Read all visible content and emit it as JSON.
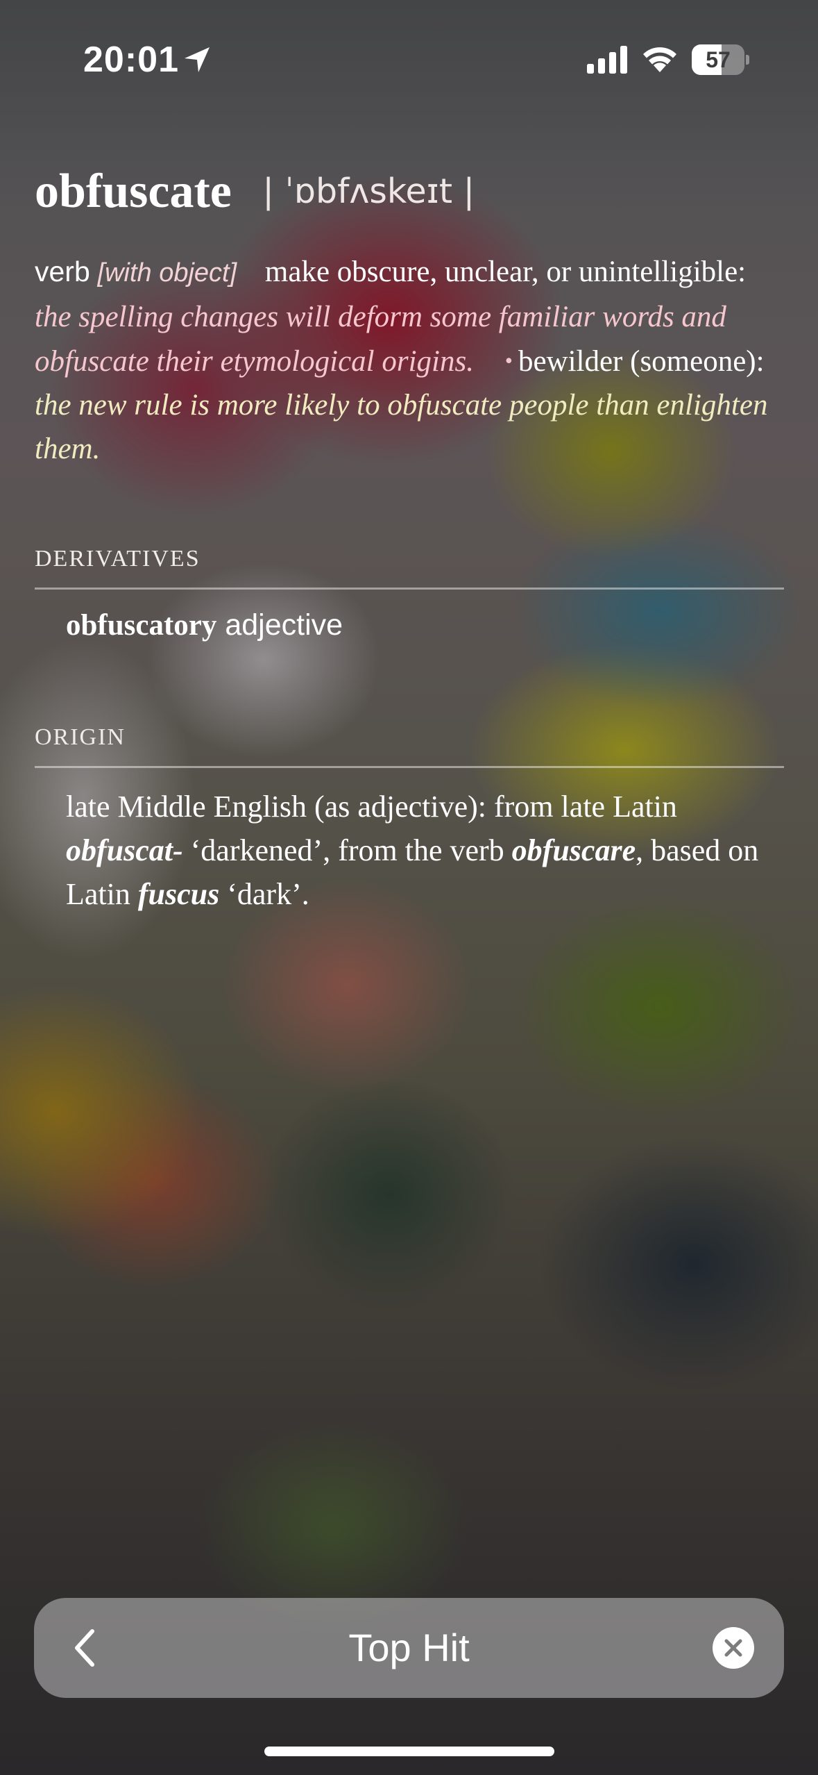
{
  "status_bar": {
    "time": "20:01",
    "battery_level": "57",
    "battery_fraction": 0.57,
    "icons": [
      "location-arrow-icon",
      "cellular-signal-icon",
      "wifi-icon",
      "battery-icon"
    ]
  },
  "entry": {
    "headword": "obfuscate",
    "pronunciation": "| ˈɒbfʌskeɪt |",
    "part_of_speech": "verb",
    "grammar_note": "[with object]",
    "sense1": {
      "definition": "make obscure, unclear, or unintelligible:",
      "example": "the spelling changes will deform some familiar words and obfuscate their etymological origins."
    },
    "bullet": "•",
    "sense2": {
      "definition": "bewilder (someone):",
      "example": "the new rule is more likely to obfuscate people than enlighten them."
    }
  },
  "derivatives": {
    "title": "DERIVATIVES",
    "word": "obfuscatory",
    "part_of_speech": "adjective"
  },
  "origin": {
    "title": "ORIGIN",
    "part1": "late Middle English (as adjective): from late Latin",
    "term1": "obfuscat-",
    "part2": "‘darkened’, from the verb",
    "term2": "obfuscare",
    "part3": ",",
    "part4": "based on Latin",
    "term3": "fuscus",
    "part5": "‘dark’."
  },
  "bottom_bar": {
    "title": "Top Hit",
    "back_icon": "chevron-left-icon",
    "clear_icon": "clear-circle-icon"
  },
  "colors": {
    "example_pink": "#f7c7cf",
    "example_yellow": "#f1ecc0"
  }
}
